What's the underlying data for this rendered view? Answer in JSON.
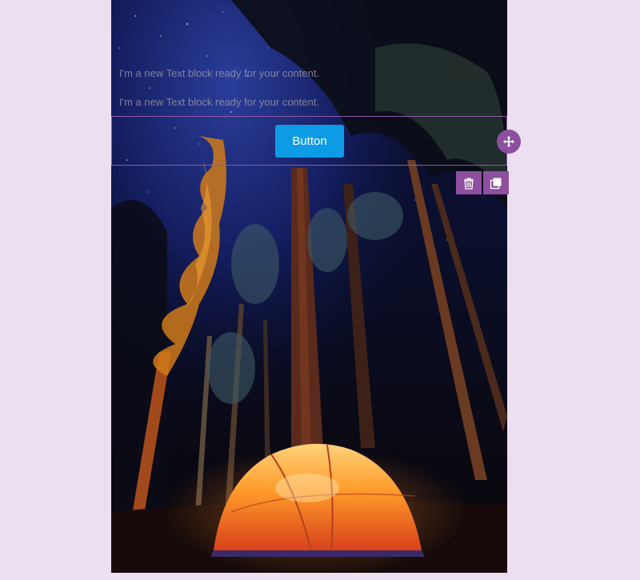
{
  "editor": {
    "text_blocks": [
      "I'm a new Text block ready for your content.",
      "I'm a new Text block ready for your content."
    ],
    "button_label": "Button",
    "toolbar": {
      "move_icon": "move-arrows-icon",
      "delete_icon": "trash-icon",
      "duplicate_icon": "duplicate-icon"
    },
    "colors": {
      "page_background": "#ecdfef",
      "accent": "#8e4f9e",
      "button": "#0d9be6"
    }
  },
  "background_image": {
    "subject": "orange-tent-under-night-forest"
  }
}
